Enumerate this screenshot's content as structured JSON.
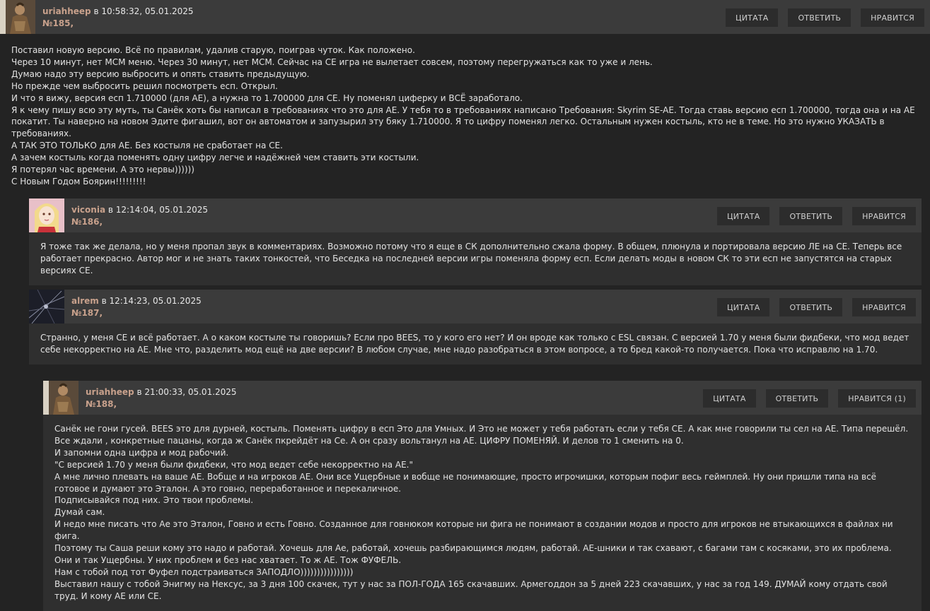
{
  "buttons": {
    "quote": "ЦИТАТА",
    "reply": "ОТВЕТИТЬ",
    "like": "НРАВИТСЯ"
  },
  "comments": [
    {
      "author": "uriahheep",
      "date_text": " в 10:58:32, 05.01.2025",
      "number": "№185",
      "like_label": "НРАВИТСЯ",
      "avatar": "warrior-avatar",
      "lines": [
        "Поставил новую версию. Всё по правилам, удалив старую, поиграв чуток. Как положено.",
        "Через 10 минут, нет МСМ меню. Через 30 минут, нет МСМ. Сейчас на СЕ игра не вылетает совсем, поэтому перегружаться как то уже и лень.",
        "Думаю надо эту версию выбросить и опять ставить предыдущую.",
        "Но прежде чем выбросить решил посмотреть есп. Открыл.",
        "И что я вижу, версия есп 1.710000 (для АЕ), а нужна то 1.700000 для СЕ. Ну поменял циферку и ВСЁ заработало.",
        "Я к чему пишу всю эту муть, ты Санёк хоть бы написал в требованиях что это для АЕ. У тебя то в требованиях написано Требования: Skyrim SE-AE. Тогда ставь версию есп 1.700000, тогда она и на АЕ покатит. Ты наверно на новом Эдите фигашил, вот он автоматом и запузырил эту бяку 1.710000. Я то цифру поменял легко. Остальным нужен костыль, кто не в теме. Но это нужно УКАЗАТЬ в требованиях.",
        "А ТАК ЭТО ТОЛЬКО для АЕ. Без костыля не сработает на СЕ.",
        "А зачем костыль когда поменять одну цифру легче и надёжней чем ставить эти костыли.",
        "Я потерял час времени. А это нервы))))))",
        "С Новым Годом Боярин!!!!!!!!!"
      ]
    },
    {
      "author": "viconia",
      "date_text": " в 12:14:04, 05.01.2025",
      "number": "№186",
      "like_label": "НРАВИТСЯ",
      "avatar": "elf-girl-avatar",
      "lines": [
        "Я тоже так же делала, но у меня пропал звук в комментариях. Возможно потому что я еще в СК дополнительно сжала форму. В общем, плюнула и портировала версию ЛЕ на СЕ. Теперь все работает прекрасно. Автор мог и не знать таких тонкостей, что Беседка на последней версии игры поменяла форму есп. Если делать моды в новом СК то эти есп не запустятся на старых версиях СЕ."
      ]
    },
    {
      "author": "alrem",
      "date_text": " в 12:14:23, 05.01.2025",
      "number": "№187",
      "like_label": "НРАВИТСЯ",
      "avatar": "dark-abstract-avatar",
      "lines": [
        "Странно, у меня СЕ и всё работает. А о каком костыле ты говоришь? Если про BEES, то у кого его нет? И он вроде как только с  ESL связан. С версией 1.70 у меня были фидбеки, что мод ведет себе некорректно на АЕ. Мне что, разделить мод ещё на две версии? В любом случае, мне надо разобраться в этом вопросе, а то бред какой-то получается. Пока что исправлю на 1.70."
      ]
    },
    {
      "author": "uriahheep",
      "date_text": " в 21:00:33, 05.01.2025",
      "number": "№188",
      "like_label": "НРАВИТСЯ (1)",
      "avatar": "warrior-avatar",
      "lines": [
        "Санёк не гони гусей. BEES это для дурней, костыль. Поменять цифру в есп Это для Умных. И Это не может у тебя работать если у тебя СЕ. А как мне говорили ты сел на АЕ. Типа перешёл. Все ждали , конкретные пацаны, когда ж Санёк пкрейдёт на Се. А он сразу вольтанул на АЕ.  ЦИФРУ ПОМЕНЯЙ. И делов то 1 сменить на 0.",
        "И запомни одна цифра и мод рабочий.",
        "\"С версией 1.70 у меня были фидбеки, что мод ведет себе некорректно на АЕ.\"",
        "А мне лично плевать на ваше АЕ. Вобще и на игроков АЕ. Они все Ущербные и вобще не понимающие, просто игрочишки, которым пофиг весь геймплей. Ну они пришли типа на всё готовое и думают это Эталон. А это говно, переработанное и перекаличное.",
        "Подписывайся под них. Это твои проблемы.",
        "Думай сам.",
        "И недо мне писать что Ае это Эталон, Говно и есть Говно. Созданное для говнюком которые ни фига не понимают в создании модов и просто для игроков не втыкающихся в файлах ни фига.",
        "Поэтому ты Саша реши кому это надо и работай. Хочешь для Ае, работай, хочешь разбирающимся людям, работай. АЕ-шники и так схавают, с багами там с косяками, это их проблема. Они и так Ущербны. У них проблем и без нас хватает. То ж АЕ. Тож ФУФЕЛЬ.",
        "Нам с тобой под тот Фуфел подстраиваться ЗАПОДЛО))))))))))))))))",
        "Выставил нашу с тобой Энигму на Нексус, за 3 дня 100 скачек, тут у нас за ПОЛ-ГОДА 165 скачавших. Армегоддон за 5 дней 223 скачавших, у нас за год 149. ДУМАЙ кому отдать свой труд. И кому  АЕ или СЕ."
      ]
    }
  ]
}
